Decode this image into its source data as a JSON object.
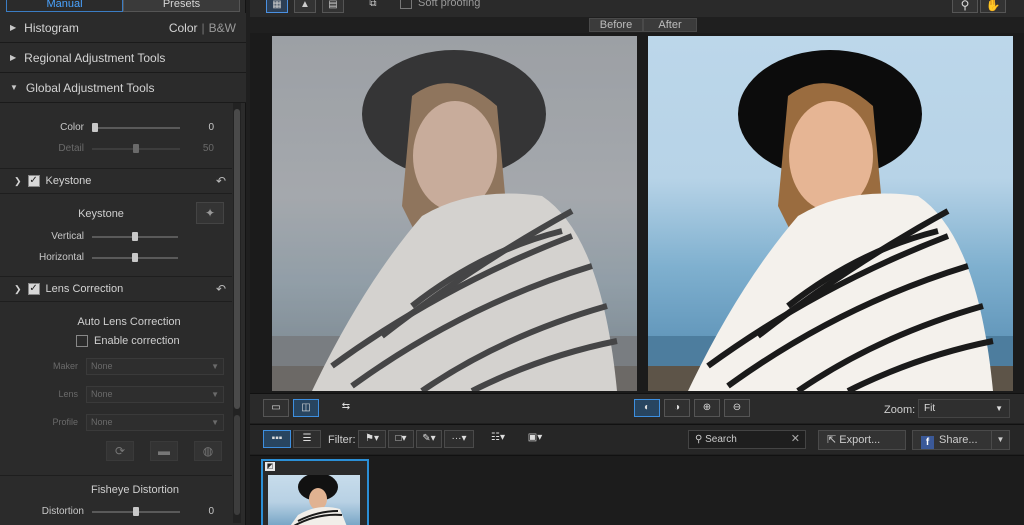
{
  "left_panel": {
    "tabs": {
      "manual": "Manual",
      "presets": "Presets"
    },
    "sections": {
      "histogram": "Histogram",
      "histogram_modes": {
        "color": "Color",
        "bw": "B&W"
      },
      "regional": "Regional Adjustment Tools",
      "global": "Global Adjustment Tools"
    },
    "color_row": {
      "label": "Color",
      "value": "0"
    },
    "detail_row": {
      "label": "Detail",
      "value": "50"
    },
    "keystone": {
      "header": "Keystone",
      "title": "Keystone",
      "vertical": "Vertical",
      "horizontal": "Horizontal"
    },
    "lens": {
      "header": "Lens Correction",
      "title": "Auto Lens Correction",
      "enable": "Enable correction",
      "maker_label": "Maker",
      "maker_value": "None",
      "lens_label": "Lens",
      "lens_value": "None",
      "profile_label": "Profile",
      "profile_value": "None"
    },
    "fisheye": {
      "title": "Fisheye Distortion",
      "distortion_label": "Distortion",
      "distortion_value": "0"
    }
  },
  "topbar": {
    "soft_proofing": "Soft proofing"
  },
  "compare": {
    "before": "Before",
    "after": "After"
  },
  "controls": {
    "zoom_label": "Zoom:",
    "zoom_value": "Fit"
  },
  "filterbar": {
    "filter_label": "Filter:",
    "search_placeholder": "Search",
    "export": "Export...",
    "share": "Share..."
  },
  "colors": {
    "accent": "#2b8fd6",
    "panel": "#2b2b2b",
    "background": "#1f1f1f"
  }
}
